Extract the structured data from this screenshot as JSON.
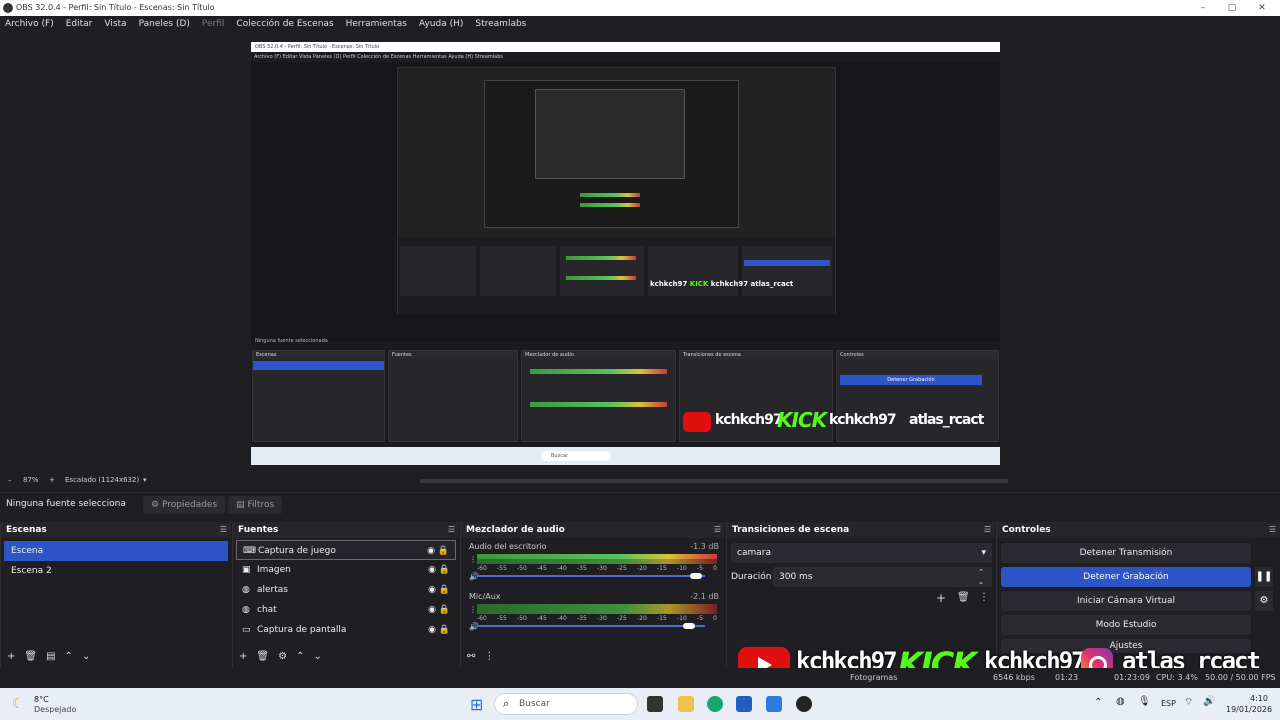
{
  "window": {
    "title": "OBS 32.0.4 - Perfil: Sin Título - Escenas: Sin Título"
  },
  "menu": [
    "Archivo (F)",
    "Editar",
    "Vista",
    "Paneles (D)",
    "Perfil",
    "Colección de Escenas",
    "Herramientas",
    "Ayuda (H)",
    "Streamlabs"
  ],
  "zoom": {
    "minus": "–",
    "level": "87%",
    "plus": "+",
    "scale": "Escalado (1124x632)"
  },
  "source_bar": {
    "none_selected": "Ninguna fuente selecciona",
    "properties": "Propiedades",
    "filters": "Filtros"
  },
  "scenes": {
    "title": "Escenas",
    "items": [
      "Escena",
      "Escena 2"
    ]
  },
  "sources": {
    "title": "Fuentes",
    "items": [
      "Captura de juego",
      "Imagen",
      "alertas",
      "chat",
      "Captura de pantalla"
    ]
  },
  "mixer": {
    "title": "Mezclador de audio",
    "channels": [
      {
        "name": "Audio del escritorio",
        "db": "-1.3 dB"
      },
      {
        "name": "Mic/Aux",
        "db": "-2.1 dB"
      }
    ],
    "scale": [
      "-60",
      "-55",
      "-50",
      "-45",
      "-40",
      "-35",
      "-30",
      "-25",
      "-20",
      "-15",
      "-10",
      "-5",
      "0"
    ]
  },
  "transitions": {
    "title": "Transiciones de escena",
    "selected": "camara",
    "duration_label": "Duración",
    "duration_value": "300 ms"
  },
  "controls": {
    "title": "Controles",
    "stop_stream": "Detener Transmisión",
    "stop_record": "Detener Grabación",
    "virtual_cam": "Iniciar Cámara Virtual",
    "studio_mode": "Modo Estudio",
    "settings": "Ajustes"
  },
  "overlay": {
    "handle1": "kchkch97",
    "kick": "KICK",
    "handle2": "kchkch97",
    "instagram": "atlas_rcact"
  },
  "status": {
    "frames": "Fotogramas",
    "kbps": "6546 kbps",
    "time1": "01:23",
    "time2": "01:23:09",
    "cpu": "CPU: 3.4%",
    "fps": "50.00 / 50.00 FPS"
  },
  "preview_inner": {
    "title": "OBS 32.0.4 - Perfil: Sin Título - Escenas: Sin Título",
    "menu": "Archivo (F)   Editar   Vista   Paneles (D)   Perfil   Colección de Escenas   Herramientas   Ayuda (H)   Streamlabs",
    "none_selected": "Ninguna fuente seleccionada",
    "scenes_title": "Escenas",
    "sources_title": "Fuentes",
    "mixer_title": "Mezclador de audio",
    "transitions_title": "Transiciones de escena",
    "controls_title": "Controles",
    "stop_record": "Detener Grabación",
    "search": "Buscar"
  },
  "taskbar": {
    "weather_temp": "8°C",
    "weather_desc": "Despejado",
    "search": "Buscar",
    "lang": "ESP",
    "time": "4:10",
    "date": "19/01/2026"
  },
  "colors": {
    "accent": "#2e55c8",
    "bg": "#1f1f23",
    "kick": "#53fc18"
  }
}
